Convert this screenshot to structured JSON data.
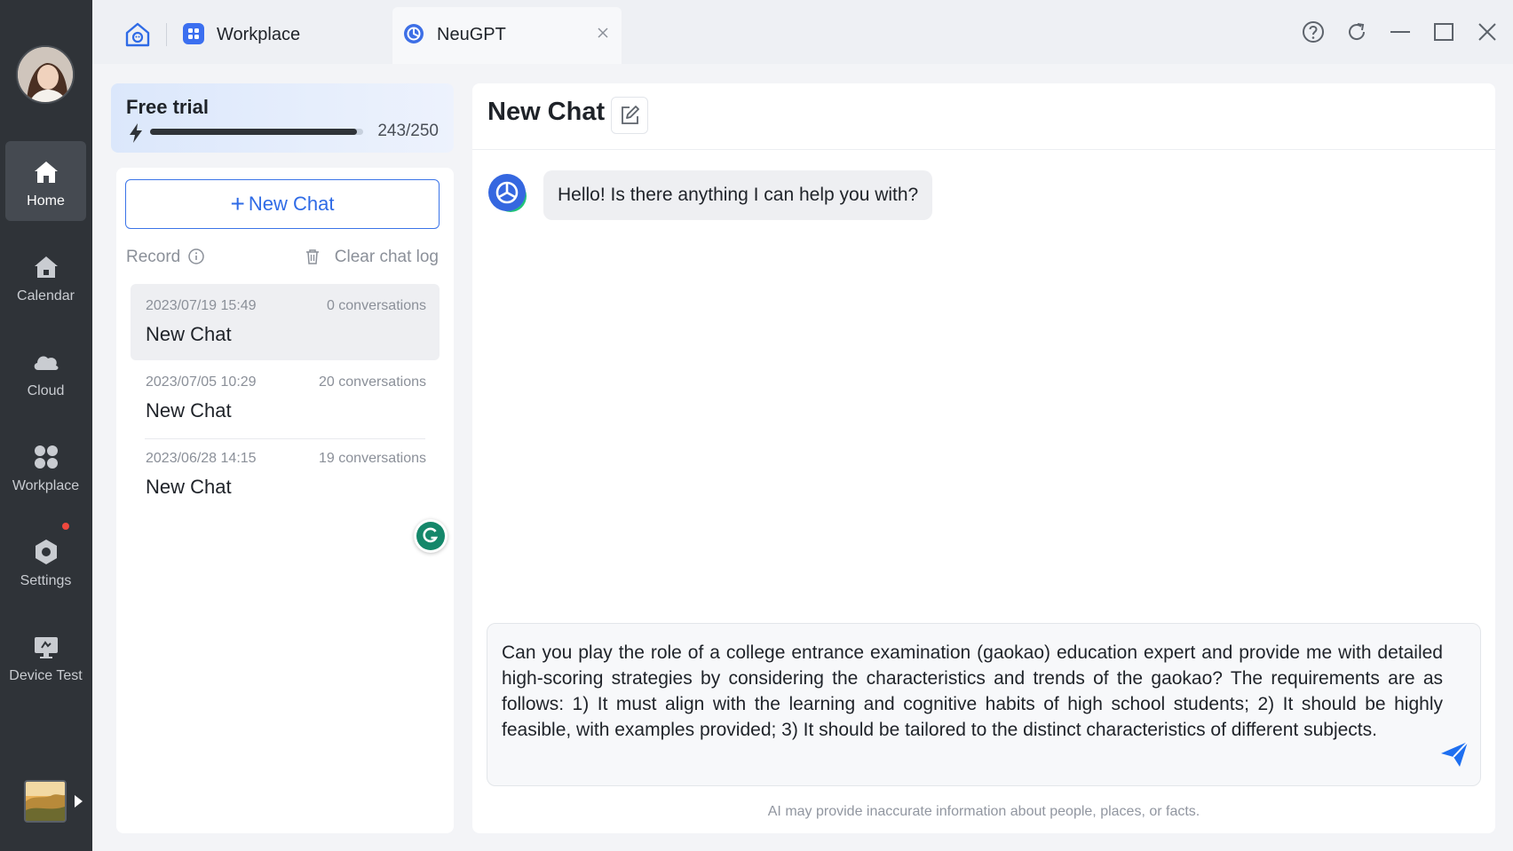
{
  "sidebar": {
    "items": [
      {
        "label": "Home",
        "icon": "home-icon",
        "active": true
      },
      {
        "label": "Calendar",
        "icon": "calendar-icon",
        "active": false
      },
      {
        "label": "Cloud",
        "icon": "cloud-icon",
        "active": false
      },
      {
        "label": "Workplace",
        "icon": "grid-icon",
        "active": false
      },
      {
        "label": "Settings",
        "icon": "settings-icon",
        "active": false,
        "notification": true
      },
      {
        "label": "Device Test",
        "icon": "monitor-icon",
        "active": false
      }
    ]
  },
  "tabs": [
    {
      "label": "Workplace",
      "icon": "workplace-app-icon",
      "active": false
    },
    {
      "label": "NeuGPT",
      "icon": "neugpt-logo-icon",
      "active": true
    }
  ],
  "trial": {
    "title": "Free trial",
    "used": 243,
    "total": 250,
    "count_text": "243/250"
  },
  "left_panel": {
    "new_chat_label": "New Chat",
    "record_label": "Record",
    "clear_label": "Clear chat log",
    "records": [
      {
        "date": "2023/07/19 15:49",
        "conversations": "0 conversations",
        "title": "New Chat",
        "selected": true
      },
      {
        "date": "2023/07/05 10:29",
        "conversations": "20 conversations",
        "title": "New Chat",
        "selected": false
      },
      {
        "date": "2023/06/28 14:15",
        "conversations": "19 conversations",
        "title": "New Chat",
        "selected": false
      }
    ]
  },
  "chat": {
    "title": "New Chat",
    "greeting": "Hello! Is there anything I can help you with?",
    "input_value": "Can you play the role of a college entrance examination (gaokao) education expert and provide me with detailed high-scoring strategies by considering the characteristics and trends of the gaokao? The requirements are as follows: 1) It must align with the learning and cognitive habits of high school students; 2) It should be highly feasible, with examples provided; 3) It should be tailored to the distinct characteristics of different subjects.",
    "disclaimer": "AI may provide inaccurate information about people, places, or facts."
  },
  "colors": {
    "accent": "#2f6be6",
    "rail": "#2f3338",
    "notification": "#f0483e"
  }
}
